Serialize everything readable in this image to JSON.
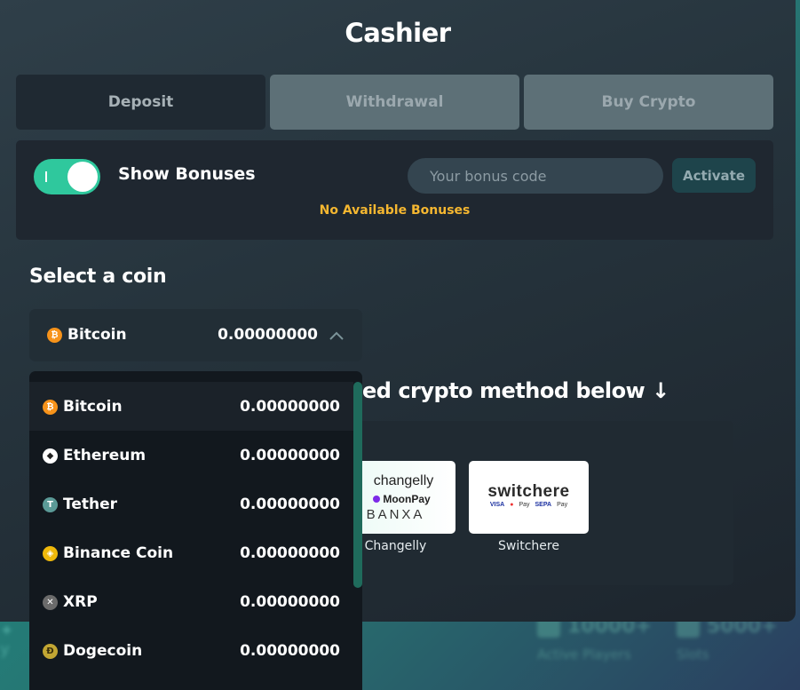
{
  "header": {
    "title": "Cashier"
  },
  "tabs": [
    {
      "label": "Deposit",
      "active": true
    },
    {
      "label": "Withdrawal",
      "active": false
    },
    {
      "label": "Buy Crypto",
      "active": false
    }
  ],
  "bonus": {
    "toggle_label": "Show Bonuses",
    "toggle_on": true,
    "code_placeholder": "Your bonus code",
    "code_value": "",
    "activate_label": "Activate",
    "status_text": "No Available Bonuses",
    "status_color": "#f5b730"
  },
  "coin_select": {
    "label": "Select a coin",
    "selected": {
      "name": "Bitcoin",
      "amount": "0.00000000",
      "icon": "bitcoin-icon"
    },
    "expanded": true,
    "chevron": "chevron-up-icon"
  },
  "dropdown": {
    "items": [
      {
        "name": "Bitcoin",
        "amount": "0.00000000",
        "icon": "bitcoin-icon",
        "glyph": "₿",
        "color": "#f7931a"
      },
      {
        "name": "Ethereum",
        "amount": "0.00000000",
        "icon": "ethereum-icon",
        "glyph": "◆",
        "color": "#ffffff"
      },
      {
        "name": "Tether",
        "amount": "0.00000000",
        "icon": "tether-icon",
        "glyph": "T",
        "color": "#5b9a97"
      },
      {
        "name": "Binance Coin",
        "amount": "0.00000000",
        "icon": "binance-coin-icon",
        "glyph": "◈",
        "color": "#f0b90b"
      },
      {
        "name": "XRP",
        "amount": "0.00000000",
        "icon": "xrp-icon",
        "glyph": "✕",
        "color": "#6b6b6b"
      },
      {
        "name": "Dogecoin",
        "amount": "0.00000000",
        "icon": "dogecoin-icon",
        "glyph": "Đ",
        "color": "#c2a633"
      }
    ]
  },
  "methods": {
    "heading_visible": "ed crypto method below ↓",
    "cards": [
      {
        "caption": "Changelly",
        "logo_lines": [
          "changelly",
          "MoonPay",
          "BANXA"
        ]
      },
      {
        "caption": "Switchere",
        "logo_lines": [
          "switchere",
          "VISA",
          "Pay",
          "SEPA",
          "Pay"
        ]
      }
    ]
  },
  "background": {
    "stats": [
      {
        "value": "10000+",
        "label": "Active Players"
      },
      {
        "value": "5000+",
        "label": "Slots"
      }
    ]
  },
  "colors": {
    "accent": "#2fc89d",
    "tab_active_bg": "#1f2932",
    "tab_inactive_bg": "#5d7077",
    "scrollbar": "#1f6b5c"
  }
}
